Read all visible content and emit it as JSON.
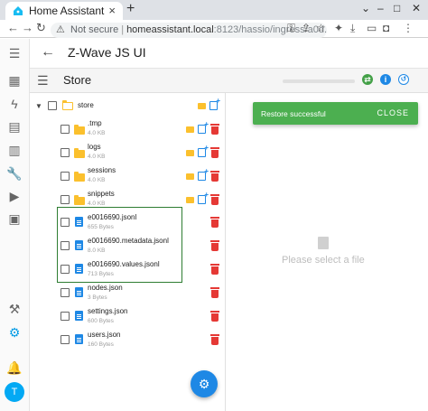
{
  "browser": {
    "tab_title": "Home Assistant",
    "new_tab": "+",
    "tab_close": "×",
    "security": "Not secure",
    "url_host": "homeassistant.local",
    "url_path": ":8123/hassio/ingress/a0d..."
  },
  "sidebar": {
    "items": [
      {
        "icon": "menu-icon",
        "glyph": "☰"
      },
      {
        "icon": "dashboard-icon",
        "glyph": "▦"
      },
      {
        "icon": "energy-icon",
        "glyph": "ϟ"
      },
      {
        "icon": "logbook-icon",
        "glyph": "▤"
      },
      {
        "icon": "history-icon",
        "glyph": "▥"
      },
      {
        "icon": "developer-icon",
        "glyph": "🔧"
      },
      {
        "icon": "media-icon",
        "glyph": "▶"
      },
      {
        "icon": "todo-icon",
        "glyph": "▣"
      },
      {
        "icon": "hammer-icon",
        "glyph": "⚒"
      },
      {
        "icon": "settings-icon",
        "glyph": "⚙"
      },
      {
        "icon": "bell-icon",
        "glyph": "🔔"
      }
    ],
    "avatar_initial": "T"
  },
  "appbar": {
    "title": "Z-Wave JS UI"
  },
  "toolbar": {
    "title": "Store"
  },
  "tree": {
    "root": {
      "name": "store"
    },
    "items": [
      {
        "name": ".tmp",
        "size": "4.0 KB",
        "type": "folder"
      },
      {
        "name": "logs",
        "size": "4.0 KB",
        "type": "folder"
      },
      {
        "name": "sessions",
        "size": "4.0 KB",
        "type": "folder"
      },
      {
        "name": "snippets",
        "size": "4.0 KB",
        "type": "folder"
      },
      {
        "name": "e0016690.jsonl",
        "size": "655 Bytes",
        "type": "file"
      },
      {
        "name": "e0016690.metadata.jsonl",
        "size": "8.0 KB",
        "type": "file"
      },
      {
        "name": "e0016690.values.jsonl",
        "size": "713 Bytes",
        "type": "file"
      },
      {
        "name": "nodes.json",
        "size": "3 Bytes",
        "type": "file"
      },
      {
        "name": "settings.json",
        "size": "600 Bytes",
        "type": "file"
      },
      {
        "name": "users.json",
        "size": "160 Bytes",
        "type": "file"
      }
    ]
  },
  "main": {
    "empty_text": "Please select a file"
  },
  "snackbar": {
    "message": "Restore successful",
    "close_label": "CLOSE"
  },
  "colors": {
    "accent": "#1e88e5",
    "folder": "#fbc02d",
    "delete": "#e53935",
    "snackbar": "#4caf50",
    "highlight": "#2e7d32"
  }
}
